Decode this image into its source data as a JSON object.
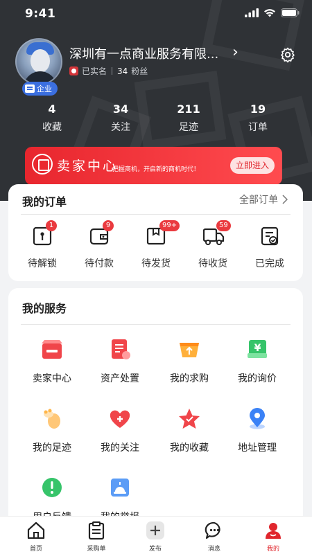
{
  "status_bar": {
    "time": "9:41"
  },
  "profile": {
    "company_name": "深圳有一点商业服务有限...",
    "verified_label": "已实名",
    "fans_count": "34",
    "fans_label": "粉丝",
    "enterprise_badge": "企业"
  },
  "stats": [
    {
      "value": "4",
      "label": "收藏"
    },
    {
      "value": "34",
      "label": "关注"
    },
    {
      "value": "211",
      "label": "足迹"
    },
    {
      "value": "19",
      "label": "订单"
    }
  ],
  "seller_banner": {
    "title": "卖家中心",
    "slogan": "把握商机，开启新的商机时代！",
    "button": "立即进入"
  },
  "orders": {
    "title": "我的订单",
    "all_label": "全部订单",
    "items": [
      {
        "label": "待解锁",
        "badge": "1",
        "icon": "lock-box-icon"
      },
      {
        "label": "待付款",
        "badge": "9",
        "icon": "wallet-icon"
      },
      {
        "label": "待发货",
        "badge": "99+",
        "icon": "package-icon"
      },
      {
        "label": "待收货",
        "badge": "59",
        "icon": "truck-icon"
      },
      {
        "label": "已完成",
        "badge": "",
        "icon": "completed-doc-icon"
      }
    ]
  },
  "services": {
    "title": "我的服务",
    "items": [
      {
        "label": "卖家中心",
        "icon": "store-icon"
      },
      {
        "label": "资产处置",
        "icon": "asset-doc-icon"
      },
      {
        "label": "我的求购",
        "icon": "purchase-basket-icon"
      },
      {
        "label": "我的询价",
        "icon": "price-inquiry-icon"
      },
      {
        "label": "我的足迹",
        "icon": "footprint-icon"
      },
      {
        "label": "我的关注",
        "icon": "heart-plus-icon"
      },
      {
        "label": "我的收藏",
        "icon": "star-icon"
      },
      {
        "label": "地址管理",
        "icon": "location-pin-icon"
      },
      {
        "label": "用户反馈",
        "icon": "feedback-alert-icon"
      },
      {
        "label": "我的举报",
        "icon": "report-icon"
      }
    ]
  },
  "tabbar": [
    {
      "label": "首页",
      "icon": "home-icon"
    },
    {
      "label": "采购单",
      "icon": "purchase-list-icon"
    },
    {
      "label": "发布",
      "icon": "publish-plus-icon"
    },
    {
      "label": "消息",
      "icon": "message-icon"
    },
    {
      "label": "我的",
      "icon": "profile-icon",
      "active": true
    }
  ],
  "colors": {
    "accent": "#e0262d",
    "header_bg": "#2f3236",
    "badge": "#ea3a3f"
  }
}
